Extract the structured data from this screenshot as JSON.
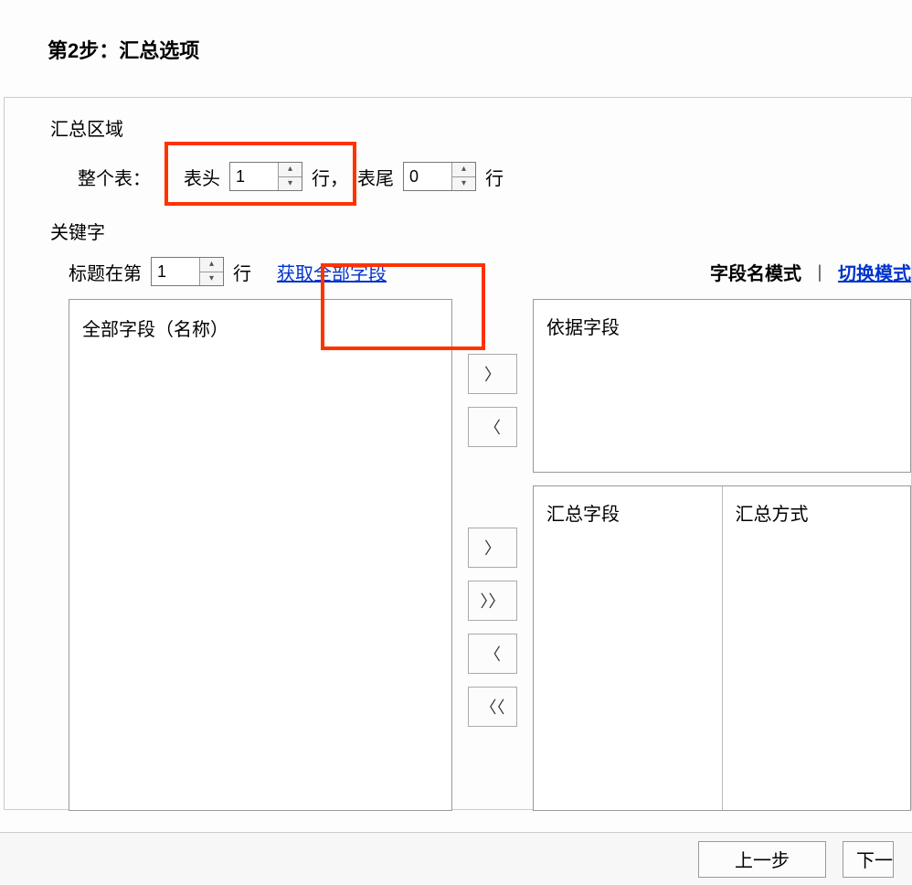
{
  "title": "第2步：汇总选项",
  "region": {
    "legend": "汇总区域",
    "whole_table_label": "整个表：",
    "header_label": "表头",
    "header_value": "1",
    "row_unit_comma": "行，",
    "footer_label": "表尾",
    "footer_value": "0",
    "row_unit": "行"
  },
  "keywords": {
    "legend": "关键字",
    "title_at_label": "标题在第",
    "title_row_value": "1",
    "row_unit": "行",
    "get_all_fields": "获取全部字段",
    "field_name_mode": "字段名模式",
    "separator": "丨",
    "switch_mode": "切换模式",
    "all_fields_label": "全部字段（名称）",
    "basis_fields_label": "依据字段",
    "summary_fields_label": "汇总字段",
    "summary_method_label": "汇总方式"
  },
  "arrows": {
    "right": "〉",
    "left": "〈",
    "right2": "〉〉",
    "left2": "〈〈"
  },
  "footer": {
    "prev": "上一步",
    "next": "下一"
  }
}
